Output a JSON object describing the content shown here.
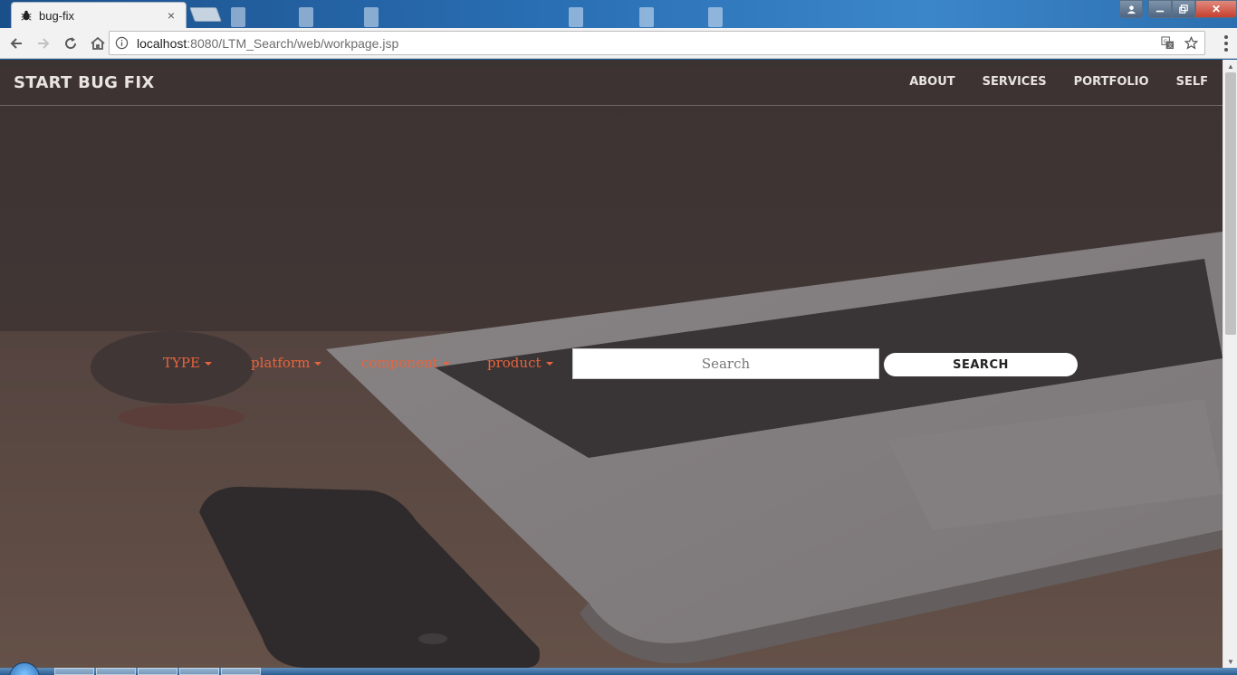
{
  "browser": {
    "tab_title": "bug-fix",
    "tab_close": "×",
    "url_host": "localhost",
    "url_rest": ":8080/LTM_Search/web/workpage.jsp",
    "window_close": "✕"
  },
  "site": {
    "brand": "START BUG FIX",
    "nav": [
      "ABOUT",
      "SERVICES",
      "PORTFOLIO",
      "SELF"
    ]
  },
  "search": {
    "dropdowns": [
      "TYPE",
      "platform",
      "component",
      "product"
    ],
    "placeholder": "Search",
    "button": "SEARCH"
  },
  "colors": {
    "accent": "#e8643e",
    "overlay": "#463c3c"
  },
  "icons": {
    "back": "arrow-left-icon",
    "forward": "arrow-right-icon",
    "reload": "reload-icon",
    "home": "home-icon",
    "info": "info-icon",
    "translate": "translate-icon",
    "bookmark": "star-icon",
    "menu": "kebab-menu-icon",
    "favicon": "bug-icon"
  }
}
